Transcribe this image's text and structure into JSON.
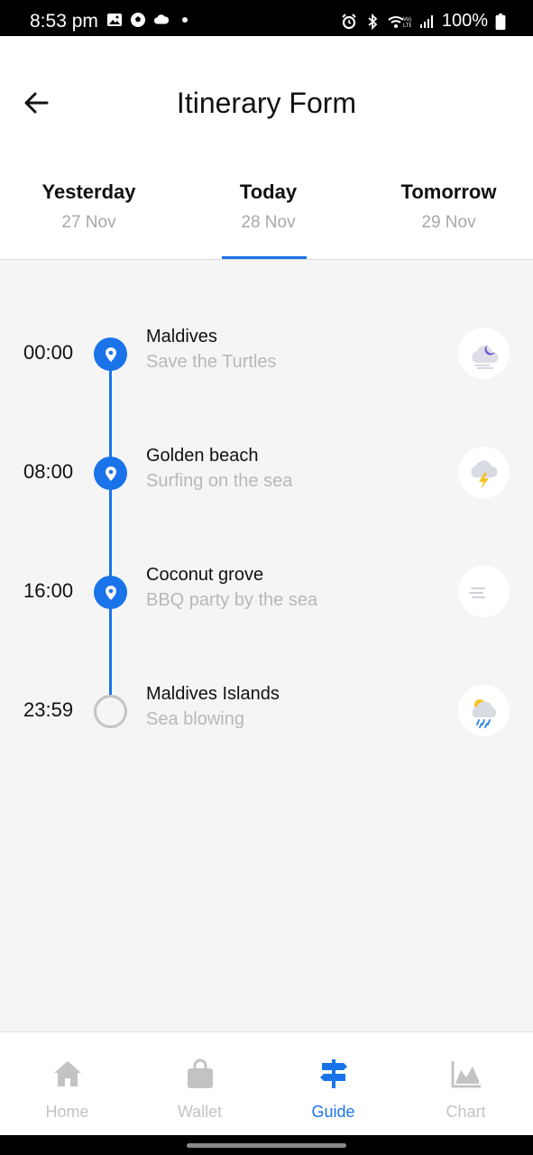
{
  "status_bar": {
    "time": "8:53 pm",
    "battery": "100%"
  },
  "header": {
    "title": "Itinerary Form"
  },
  "tabs": [
    {
      "day": "Yesterday",
      "date": "27 Nov"
    },
    {
      "day": "Today",
      "date": "28 Nov",
      "active": true
    },
    {
      "day": "Tomorrow",
      "date": "29 Nov"
    }
  ],
  "timeline": [
    {
      "time": "00:00",
      "title": "Maldives",
      "subtitle": "Save the Turtles",
      "weather_icon": "night-cloud-wind-icon"
    },
    {
      "time": "08:00",
      "title": "Golden beach",
      "subtitle": "Surfing on the sea",
      "weather_icon": "thunderstorm-icon"
    },
    {
      "time": "16:00",
      "title": "Coconut grove",
      "subtitle": "BBQ party by the sea",
      "weather_icon": "windy-moon-icon"
    },
    {
      "time": "23:59",
      "title": "Maldives Islands",
      "subtitle": "Sea blowing",
      "weather_icon": "sun-rain-icon"
    }
  ],
  "bottom_nav": [
    {
      "label": "Home",
      "icon": "home-icon"
    },
    {
      "label": "Wallet",
      "icon": "shopping-bag-icon"
    },
    {
      "label": "Guide",
      "icon": "signpost-icon",
      "active": true
    },
    {
      "label": "Chart",
      "icon": "area-chart-icon"
    }
  ],
  "colors": {
    "accent": "#1a73e8",
    "inactive": "#c3c3c3",
    "subtitle": "#b8b8b8",
    "background": "#f5f5f5"
  }
}
